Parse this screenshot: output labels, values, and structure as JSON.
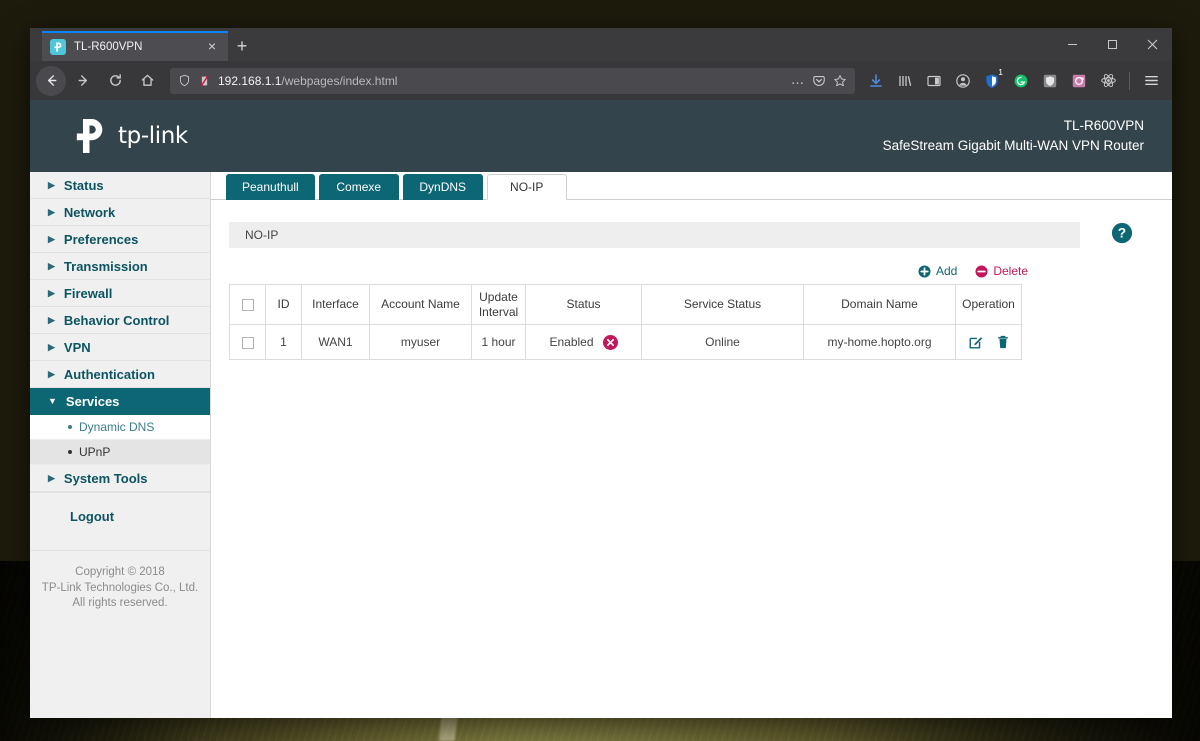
{
  "browser": {
    "tab": {
      "title": "TL-R600VPN",
      "favicon": "tplink-favicon",
      "close": "×"
    },
    "new_tab_label": "+",
    "window_controls": {
      "minimize": "minimize-icon",
      "maximize": "maximize-icon",
      "close": "close-icon"
    },
    "nav": {
      "back": "back-arrow-icon",
      "forward": "forward-arrow-icon",
      "reload": "reload-icon",
      "home": "home-icon"
    },
    "url": {
      "host": "192.168.1.1",
      "path": "/webpages/index.html",
      "full": "192.168.1.1/webpages/index.html",
      "shield_icon": "tracking-protection-shield-icon",
      "permission_icon": "permissions-icon",
      "page_actions": "…",
      "pocket_icon": "pocket-icon",
      "bookmark_icon": "star-bookmark-icon"
    },
    "toolbar_icons": [
      {
        "name": "downloads-icon"
      },
      {
        "name": "library-icon"
      },
      {
        "name": "sidebar-icon"
      },
      {
        "name": "account-icon"
      },
      {
        "name": "bitwarden-extension-icon",
        "badge": "1"
      },
      {
        "name": "grammarly-extension-icon"
      },
      {
        "name": "ublock-extension-icon"
      },
      {
        "name": "screenshot-extension-icon"
      },
      {
        "name": "react-devtools-icon"
      }
    ],
    "menu_icon": "hamburger-menu-icon"
  },
  "header": {
    "brand": "tp-link",
    "model_name": "TL-R600VPN",
    "model_description": "SafeStream Gigabit Multi-WAN VPN Router"
  },
  "sidebar": {
    "items": [
      {
        "label": "Status",
        "expanded": false
      },
      {
        "label": "Network",
        "expanded": false
      },
      {
        "label": "Preferences",
        "expanded": false
      },
      {
        "label": "Transmission",
        "expanded": false
      },
      {
        "label": "Firewall",
        "expanded": false
      },
      {
        "label": "Behavior Control",
        "expanded": false
      },
      {
        "label": "VPN",
        "expanded": false
      },
      {
        "label": "Authentication",
        "expanded": false
      },
      {
        "label": "Services",
        "expanded": true
      },
      {
        "label": "System Tools",
        "expanded": false
      }
    ],
    "sub_items": [
      {
        "label": "Dynamic DNS",
        "selected": false
      },
      {
        "label": "UPnP",
        "selected": true
      }
    ],
    "logout_label": "Logout",
    "copyright": [
      "Copyright © 2018",
      "TP-Link Technologies Co., Ltd.",
      "All rights reserved."
    ],
    "caret_collapsed": "▶",
    "caret_expanded": "▼"
  },
  "main": {
    "tabs": [
      {
        "label": "Peanuthull",
        "active": false
      },
      {
        "label": "Comexe",
        "active": false
      },
      {
        "label": "DynDNS",
        "active": false
      },
      {
        "label": "NO-IP",
        "active": true
      }
    ],
    "panel_title": "NO-IP",
    "help_icon": "help-question-icon",
    "actions": [
      {
        "label": "Add",
        "icon": "plus-circle-icon",
        "color": "#0d6673"
      },
      {
        "label": "Delete",
        "icon": "minus-circle-icon",
        "color": "#c2185b"
      }
    ],
    "table": {
      "select_all": "select-all-checkbox",
      "columns": [
        "",
        "ID",
        "Interface",
        "Account Name",
        "Update Interval",
        "Status",
        "Service Status",
        "Domain Name",
        "Operation"
      ],
      "rows": [
        {
          "checked": false,
          "id": "1",
          "interface": "WAN1",
          "account_name": "myuser",
          "update_interval": "1 hour",
          "status": "Enabled",
          "status_icon": "disconnect-x-icon",
          "service_status": "Online",
          "domain_name": "my-home.hopto.org",
          "operations": [
            {
              "icon": "edit-icon"
            },
            {
              "icon": "delete-trash-icon"
            }
          ]
        }
      ]
    }
  },
  "colors": {
    "brand_teal": "#0d6673",
    "header_bg": "#34444c",
    "accent_crimson": "#c2185b",
    "sidebar_bg": "#f0f0f0"
  }
}
